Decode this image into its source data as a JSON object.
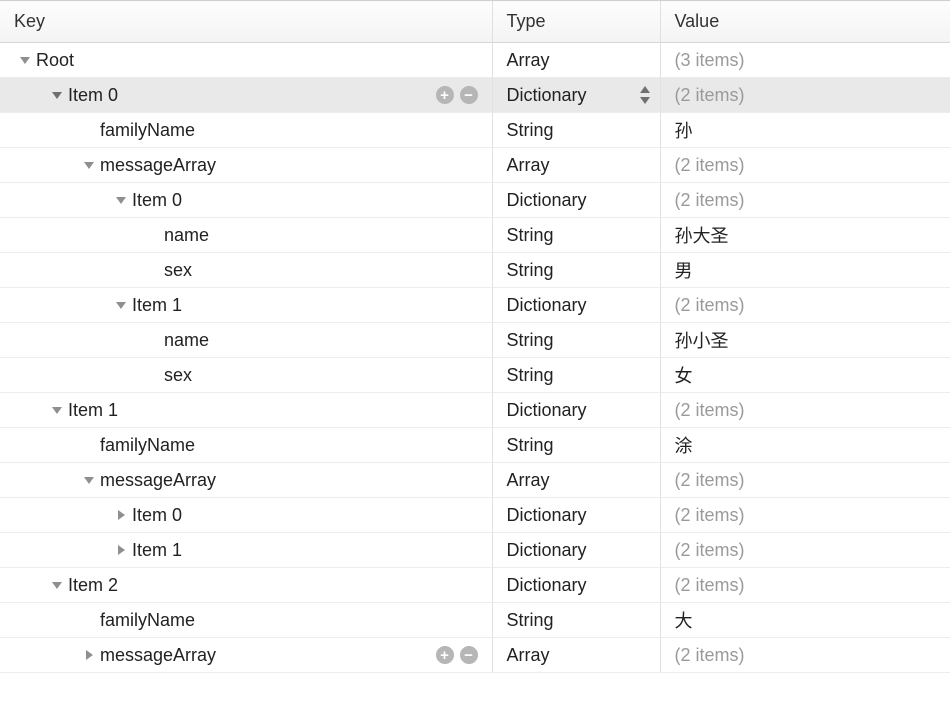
{
  "columns": {
    "key": "Key",
    "type": "Type",
    "value": "Value"
  },
  "rows": [
    {
      "indent": 0,
      "expanded": true,
      "selected": false,
      "showButtons": false,
      "showStepper": false,
      "key": "Root",
      "type": "Array",
      "value": "(3 items)",
      "dim": true
    },
    {
      "indent": 1,
      "expanded": true,
      "selected": true,
      "showButtons": true,
      "showStepper": true,
      "key": "Item 0",
      "type": "Dictionary",
      "value": "(2 items)",
      "dim": true
    },
    {
      "indent": 2,
      "expanded": null,
      "selected": false,
      "showButtons": false,
      "showStepper": false,
      "key": "familyName",
      "type": "String",
      "value": "孙",
      "dim": false
    },
    {
      "indent": 2,
      "expanded": true,
      "selected": false,
      "showButtons": false,
      "showStepper": false,
      "key": "messageArray",
      "type": "Array",
      "value": "(2 items)",
      "dim": true
    },
    {
      "indent": 3,
      "expanded": true,
      "selected": false,
      "showButtons": false,
      "showStepper": false,
      "key": "Item 0",
      "type": "Dictionary",
      "value": "(2 items)",
      "dim": true
    },
    {
      "indent": 4,
      "expanded": null,
      "selected": false,
      "showButtons": false,
      "showStepper": false,
      "key": "name",
      "type": "String",
      "value": "孙大圣",
      "dim": false
    },
    {
      "indent": 4,
      "expanded": null,
      "selected": false,
      "showButtons": false,
      "showStepper": false,
      "key": "sex",
      "type": "String",
      "value": "男",
      "dim": false
    },
    {
      "indent": 3,
      "expanded": true,
      "selected": false,
      "showButtons": false,
      "showStepper": false,
      "key": "Item 1",
      "type": "Dictionary",
      "value": "(2 items)",
      "dim": true
    },
    {
      "indent": 4,
      "expanded": null,
      "selected": false,
      "showButtons": false,
      "showStepper": false,
      "key": "name",
      "type": "String",
      "value": "孙小圣",
      "dim": false
    },
    {
      "indent": 4,
      "expanded": null,
      "selected": false,
      "showButtons": false,
      "showStepper": false,
      "key": "sex",
      "type": "String",
      "value": "女",
      "dim": false
    },
    {
      "indent": 1,
      "expanded": true,
      "selected": false,
      "showButtons": false,
      "showStepper": false,
      "key": "Item 1",
      "type": "Dictionary",
      "value": "(2 items)",
      "dim": true
    },
    {
      "indent": 2,
      "expanded": null,
      "selected": false,
      "showButtons": false,
      "showStepper": false,
      "key": "familyName",
      "type": "String",
      "value": "涂",
      "dim": false
    },
    {
      "indent": 2,
      "expanded": true,
      "selected": false,
      "showButtons": false,
      "showStepper": false,
      "key": "messageArray",
      "type": "Array",
      "value": "(2 items)",
      "dim": true
    },
    {
      "indent": 3,
      "expanded": false,
      "selected": false,
      "showButtons": false,
      "showStepper": false,
      "key": "Item 0",
      "type": "Dictionary",
      "value": "(2 items)",
      "dim": true
    },
    {
      "indent": 3,
      "expanded": false,
      "selected": false,
      "showButtons": false,
      "showStepper": false,
      "key": "Item 1",
      "type": "Dictionary",
      "value": "(2 items)",
      "dim": true
    },
    {
      "indent": 1,
      "expanded": true,
      "selected": false,
      "showButtons": false,
      "showStepper": false,
      "key": "Item 2",
      "type": "Dictionary",
      "value": "(2 items)",
      "dim": true
    },
    {
      "indent": 2,
      "expanded": null,
      "selected": false,
      "showButtons": false,
      "showStepper": false,
      "key": "familyName",
      "type": "String",
      "value": "大",
      "dim": false
    },
    {
      "indent": 2,
      "expanded": false,
      "selected": false,
      "showButtons": true,
      "showStepper": false,
      "key": "messageArray",
      "type": "Array",
      "value": "(2 items)",
      "dim": true
    }
  ],
  "indentUnit": 32,
  "basePad": 18
}
